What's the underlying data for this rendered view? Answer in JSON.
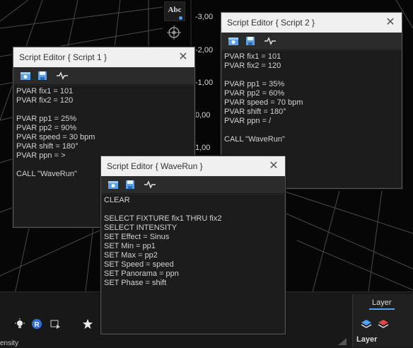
{
  "viewport": {
    "tool_label": "Abc",
    "y_axis_labels": [
      "-3,00",
      "-2,00",
      "-1,00",
      "0,00",
      "1,00"
    ]
  },
  "windows": {
    "script1": {
      "title": "Script Editor   { Script 1 }",
      "close": "✕",
      "content": "PVAR fix1 = 101\nPVAR fix2 = 120\n\nPVAR pp1 = 25%\nPVAR pp2 = 90%\nPVAR speed = 30 bpm\nPVAR shift = 180°\nPVAR ppn = >\n\nCALL \"WaveRun\""
    },
    "script2": {
      "title": "Script Editor   { Script 2 }",
      "close": "✕",
      "content": "PVAR fix1 = 101\nPVAR fix2 = 120\n\nPVAR pp1 = 35%\nPVAR pp2 = 60%\nPVAR speed = 70 bpm\nPVAR shift = 180°\nPVAR ppn = /\n\nCALL \"WaveRun\""
    },
    "waverun": {
      "title": "Script Editor   { WaveRun }",
      "close": "✕",
      "content": "CLEAR\n\nSELECT FIXTURE fix1 THRU fix2\nSELECT INTENSITY\nSET Effect = Sinus\nSET Min = pp1\nSET Max = pp2\nSET Speed = speed\nSET Panorama = ppn\nSET Phase = shift"
    }
  },
  "bottom": {
    "intensity_label": "ensity",
    "layer_tab": "Layer",
    "layer_heading": "Layer"
  },
  "colors": {
    "accent": "#4aa3ff",
    "titlebar": "#f0f0f0",
    "editor_bg": "#1c1c1c"
  }
}
